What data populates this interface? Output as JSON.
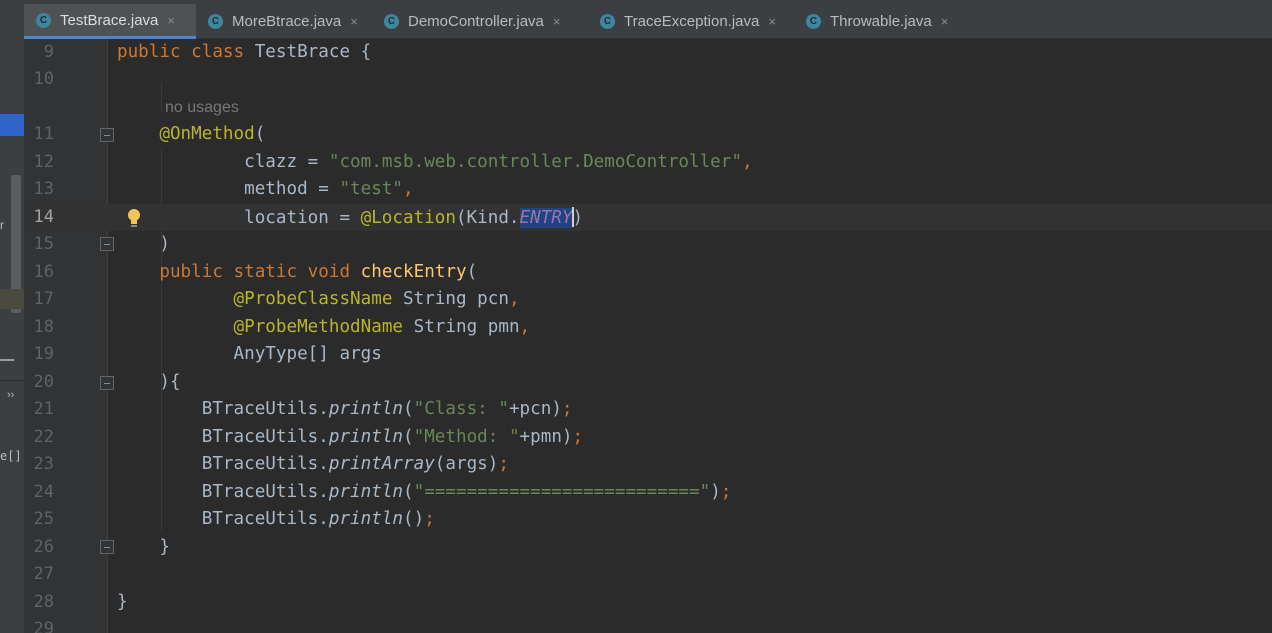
{
  "tabs": [
    {
      "label": "TestBrace.java",
      "icon": "C",
      "active": true
    },
    {
      "label": "MoreBtrace.java",
      "icon": "C",
      "active": false
    },
    {
      "label": "DemoController.java",
      "icon": "C",
      "active": false
    },
    {
      "label": "TraceException.java",
      "icon": "C",
      "active": false
    },
    {
      "label": "Throwable.java",
      "icon": "C",
      "active": false
    }
  ],
  "tab_close_glyph": "×",
  "left_panel": {
    "fragment_r": "r",
    "chevron": "››",
    "fragment_code": "e[]):"
  },
  "editor": {
    "hint": "no usages",
    "current_line": "14",
    "lines": [
      {
        "num": "9",
        "text": "public class TestBrace {"
      },
      {
        "num": "10",
        "text": ""
      },
      {
        "num": "11",
        "text": "    @OnMethod("
      },
      {
        "num": "12",
        "text": "            clazz = \"com.msb.web.controller.DemoController\","
      },
      {
        "num": "13",
        "text": "            method = \"test\","
      },
      {
        "num": "14",
        "text": "            location = @Location(Kind.ENTRY)"
      },
      {
        "num": "15",
        "text": "    )"
      },
      {
        "num": "16",
        "text": "    public static void checkEntry("
      },
      {
        "num": "17",
        "text": "           @ProbeClassName String pcn,"
      },
      {
        "num": "18",
        "text": "           @ProbeMethodName String pmn,"
      },
      {
        "num": "19",
        "text": "           AnyType[] args"
      },
      {
        "num": "20",
        "text": "    ){"
      },
      {
        "num": "21",
        "text": "        BTraceUtils.println(\"Class: \"+pcn);"
      },
      {
        "num": "22",
        "text": "        BTraceUtils.println(\"Method: \"+pmn);"
      },
      {
        "num": "23",
        "text": "        BTraceUtils.printArray(args);"
      },
      {
        "num": "24",
        "text": "        BTraceUtils.println(\"==========================\");"
      },
      {
        "num": "25",
        "text": "        BTraceUtils.println();"
      },
      {
        "num": "26",
        "text": "    }"
      },
      {
        "num": "27",
        "text": ""
      },
      {
        "num": "28",
        "text": "}"
      },
      {
        "num": "29",
        "text": ""
      }
    ]
  },
  "colors": {
    "background": "#2b2b2b",
    "keyword": "#cc7832",
    "annotation": "#bbb529",
    "string": "#6a8759",
    "method_declaration": "#ffc66d",
    "constant": "#9876aa",
    "default_text": "#a9b7c6",
    "selection": "#214283"
  }
}
